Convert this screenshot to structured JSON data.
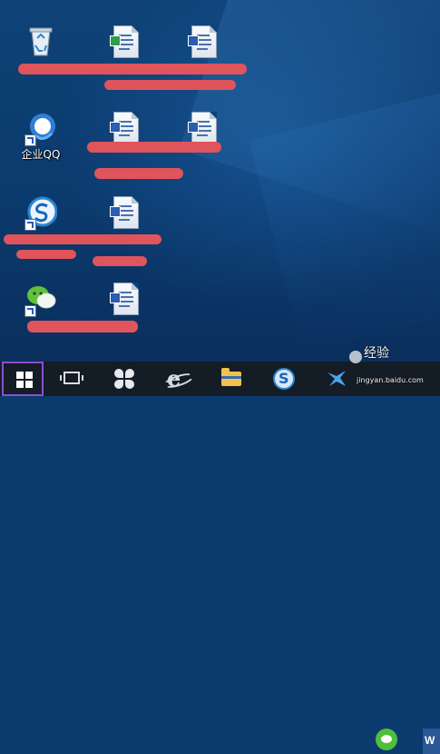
{
  "desktop": {
    "icons": [
      {
        "id": "recycle-bin",
        "label": ""
      },
      {
        "id": "doc-1",
        "label": ""
      },
      {
        "id": "doc-2",
        "label": ""
      },
      {
        "id": "qq-enterprise",
        "label": "企业QQ"
      },
      {
        "id": "doc-3",
        "label": ""
      },
      {
        "id": "doc-4",
        "label": ""
      },
      {
        "id": "sogou-browser",
        "label": ""
      },
      {
        "id": "doc-5",
        "label": ""
      },
      {
        "id": "wechat",
        "label": ""
      },
      {
        "id": "doc-6",
        "label": ""
      }
    ]
  },
  "taskbar": {
    "items": [
      {
        "name": "start-button",
        "icon": "windows-logo-icon"
      },
      {
        "name": "task-view-button",
        "icon": "task-view-icon"
      },
      {
        "name": "pinwheel-app-button",
        "icon": "pinwheel-icon"
      },
      {
        "name": "internet-explorer-button",
        "icon": "ie-icon"
      },
      {
        "name": "file-explorer-button",
        "icon": "folder-icon"
      },
      {
        "name": "sogou-button",
        "icon": "sogou-icon"
      },
      {
        "name": "bird-app-button",
        "icon": "bird-icon"
      },
      {
        "name": "wechat-button",
        "icon": "wechat-icon"
      },
      {
        "name": "word-button",
        "icon": "word-icon"
      }
    ],
    "ie_glyph": "e",
    "sogou_glyph": "S",
    "word_glyph": "W"
  },
  "watermark": {
    "text": "经验",
    "url": "jingyan.baidu.com"
  },
  "colors": {
    "desktop": "#0b3a6e",
    "taskbar": "#141c26",
    "redaction": "#e0545b",
    "start_highlight": "#8a4fcf"
  }
}
